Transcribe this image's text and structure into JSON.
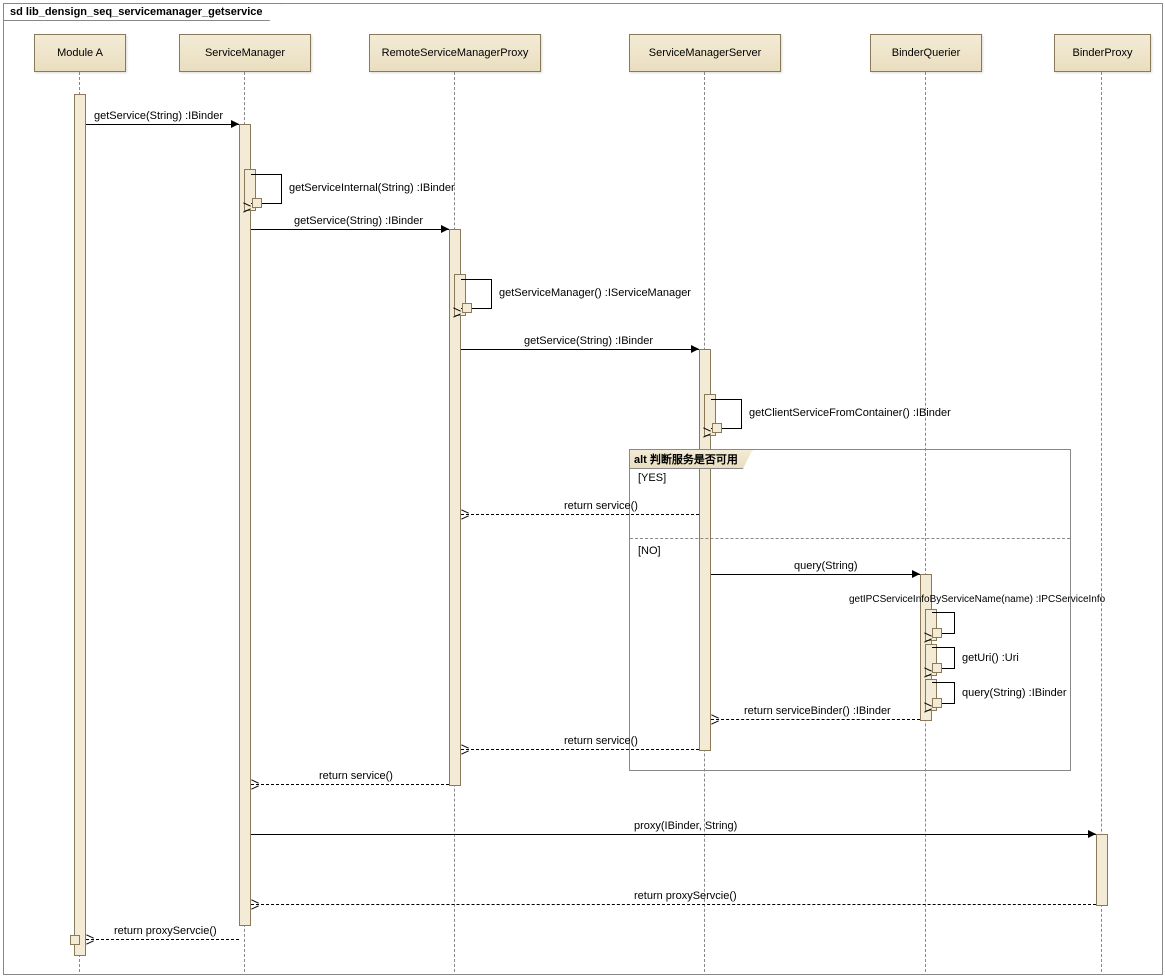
{
  "diagram": {
    "title": "sd lib_densign_seq_servicemanager_getservice",
    "lifelines": {
      "moduleA": "Module A",
      "serviceManager": "ServiceManager",
      "remoteProxy": "RemoteServiceManagerProxy",
      "serverSM": "ServiceManagerServer",
      "binderQuerier": "BinderQuerier",
      "binderProxy": "BinderProxy"
    },
    "messages": {
      "m1": "getService(String) :IBinder",
      "m2": "getServiceInternal(String) :IBinder",
      "m3": "getService(String) :IBinder",
      "m4": "getServiceManager() :IServiceManager",
      "m5": "getService(String) :IBinder",
      "m6": "getClientServiceFromContainer() :IBinder",
      "m7": "return service()",
      "m8": "query(String)",
      "m9": "getIPCServiceInfoByServiceName(name) :IPCServiceInfo",
      "m10": "getUri() :Uri",
      "m11": "query(String) :IBinder",
      "m12": "return serviceBinder() :IBinder",
      "m13": "return service()",
      "m14": "return service()",
      "m15": "proxy(IBinder, String)",
      "m16": "return proxyServcie()",
      "m17": "return proxyServcie()"
    },
    "alt": {
      "label": "alt 判断服务是否可用",
      "guard_yes": "[YES]",
      "guard_no": "[NO]"
    }
  }
}
